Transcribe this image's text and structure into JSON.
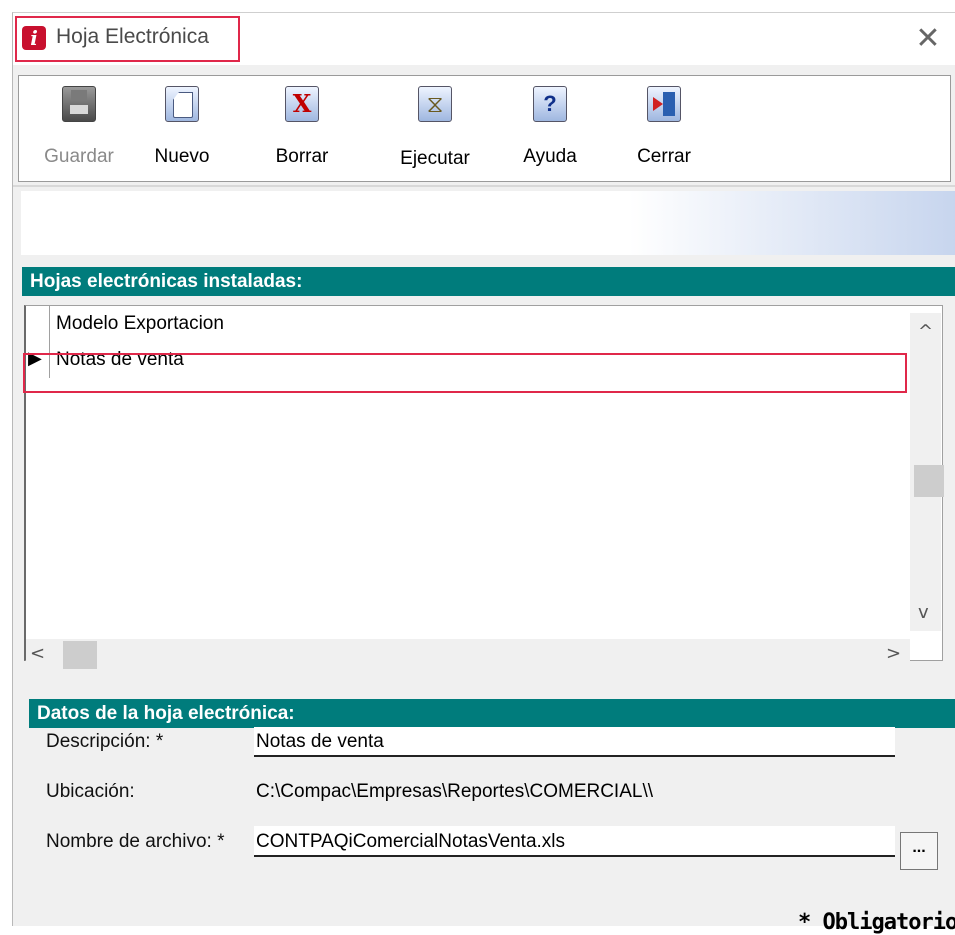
{
  "window": {
    "title": "Hoja Electrónica",
    "close_glyph": "✕",
    "app_icon_glyph": "i"
  },
  "toolbar": {
    "buttons": [
      {
        "label": "Guardar",
        "icon": "save-icon",
        "enabled": false
      },
      {
        "label": "Nuevo",
        "icon": "new-document-icon",
        "enabled": true
      },
      {
        "label": "Borrar",
        "icon": "delete-x-icon",
        "enabled": true
      },
      {
        "label": "Ejecutar",
        "icon": "hourglass-icon",
        "enabled": true
      },
      {
        "label": "Ayuda",
        "icon": "help-question-icon",
        "enabled": true
      },
      {
        "label": "Cerrar",
        "icon": "exit-door-icon",
        "enabled": true
      }
    ]
  },
  "list": {
    "header": "Hojas electrónicas instaladas:",
    "rows": [
      {
        "name": "Modelo Exportacion",
        "selected": false
      },
      {
        "name": "Notas de venta",
        "selected": true
      }
    ],
    "selected_marker": "▶"
  },
  "scroll": {
    "up": "^",
    "down": "v",
    "left": "<",
    "right": ">"
  },
  "details": {
    "header": "Datos de la hoja electrónica:",
    "description_label": "Descripción: *",
    "description_value": "Notas de venta",
    "location_label": "Ubicación:",
    "location_value": "C:\\Compac\\Empresas\\Reportes\\COMERCIAL\\\\",
    "filename_label": "Nombre de archivo: *",
    "filename_value": "CONTPAQiComercialNotasVenta.xls",
    "browse_label": "..."
  },
  "required_note": "* Obligatorio",
  "colors": {
    "section_header": "#007c7c",
    "highlight": "#e0284a",
    "brand": "#c8102e"
  }
}
